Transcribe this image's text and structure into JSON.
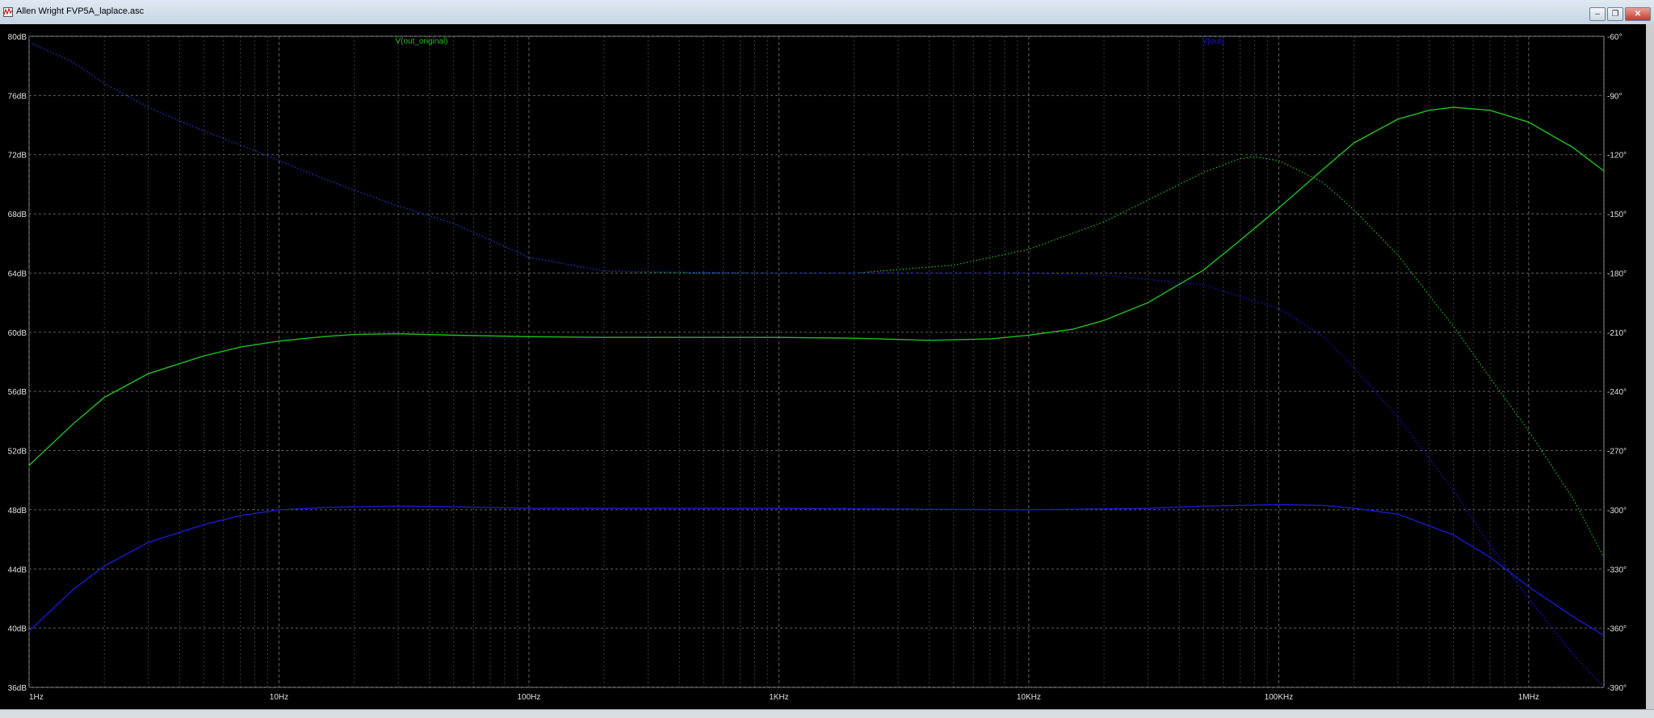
{
  "window": {
    "title": "Allen Wright FVP5A_laplace.asc"
  },
  "icons": {
    "app": "ltspice-waveform-icon",
    "minimize": "minimize-icon",
    "restore": "restore-icon",
    "close": "close-icon"
  },
  "colors": {
    "green": "#1fbf1f",
    "blue": "#1a1ad0",
    "grid": "#6a6a6a",
    "axis_text": "#e0e0e0",
    "background": "#000000"
  },
  "chart_data": {
    "type": "line",
    "title": "",
    "xscale": "log",
    "xlim": [
      1,
      2000000
    ],
    "ylim": [
      36,
      80
    ],
    "y2lim": [
      -390,
      -60
    ],
    "xticks": [
      {
        "value": 1,
        "label": "1Hz"
      },
      {
        "value": 10,
        "label": "10Hz"
      },
      {
        "value": 100,
        "label": "100Hz"
      },
      {
        "value": 1000,
        "label": "1KHz"
      },
      {
        "value": 10000,
        "label": "10KHz"
      },
      {
        "value": 100000,
        "label": "100KHz"
      },
      {
        "value": 1000000,
        "label": "1MHz"
      }
    ],
    "yticks": [
      {
        "value": 80,
        "label": "80dB"
      },
      {
        "value": 76,
        "label": "76dB"
      },
      {
        "value": 72,
        "label": "72dB"
      },
      {
        "value": 68,
        "label": "68dB"
      },
      {
        "value": 64,
        "label": "64dB"
      },
      {
        "value": 60,
        "label": "60dB"
      },
      {
        "value": 56,
        "label": "56dB"
      },
      {
        "value": 52,
        "label": "52dB"
      },
      {
        "value": 48,
        "label": "48dB"
      },
      {
        "value": 44,
        "label": "44dB"
      },
      {
        "value": 40,
        "label": "40dB"
      },
      {
        "value": 36,
        "label": "36dB"
      }
    ],
    "y2ticks": [
      {
        "value": -60,
        "label": "-60°"
      },
      {
        "value": -90,
        "label": "-90°"
      },
      {
        "value": -120,
        "label": "-120°"
      },
      {
        "value": -150,
        "label": "-150°"
      },
      {
        "value": -180,
        "label": "-180°"
      },
      {
        "value": -210,
        "label": "-210°"
      },
      {
        "value": -240,
        "label": "-240°"
      },
      {
        "value": -270,
        "label": "-270°"
      },
      {
        "value": -300,
        "label": "-300°"
      },
      {
        "value": -330,
        "label": "-330°"
      },
      {
        "value": -360,
        "label": "-360°"
      },
      {
        "value": -390,
        "label": "-390°"
      }
    ],
    "grid": true,
    "legend": [
      {
        "label": "V(out_original)",
        "color": "#1fbf1f",
        "position": "top-left"
      },
      {
        "label": "V(out)",
        "color": "#1a1ad0",
        "position": "top-right"
      }
    ],
    "series": [
      {
        "name": "V(out_original)",
        "quantity": "magnitude",
        "axis": "left",
        "style": "solid",
        "color": "#1fbf1f",
        "x": [
          1,
          1.5,
          2,
          3,
          5,
          7,
          10,
          15,
          20,
          30,
          50,
          100,
          200,
          500,
          1000,
          2000,
          4000,
          7000,
          10000,
          15000,
          20000,
          30000,
          50000,
          70000,
          100000,
          150000,
          200000,
          300000,
          400000,
          500000,
          700000,
          1000000,
          1500000,
          2000000
        ],
        "y": [
          51,
          53.8,
          55.6,
          57.2,
          58.4,
          59.0,
          59.4,
          59.7,
          59.85,
          59.9,
          59.8,
          59.7,
          59.65,
          59.65,
          59.65,
          59.6,
          59.45,
          59.55,
          59.8,
          60.2,
          60.8,
          62.0,
          64.2,
          66.2,
          68.4,
          71.0,
          72.8,
          74.4,
          75.0,
          75.2,
          75.0,
          74.2,
          72.5,
          70.9
        ]
      },
      {
        "name": "V(out_original)",
        "quantity": "phase",
        "axis": "right",
        "style": "dotted",
        "color": "#1fbf1f",
        "x": [
          1,
          1.5,
          2,
          3,
          5,
          7,
          10,
          15,
          20,
          30,
          50,
          100,
          200,
          500,
          1000,
          2000,
          5000,
          10000,
          20000,
          30000,
          50000,
          70000,
          80000,
          100000,
          150000,
          200000,
          300000,
          500000,
          700000,
          1000000,
          1500000,
          2000000
        ],
        "y": [
          -63,
          -73,
          -84,
          -96,
          -108,
          -115,
          -123,
          -132,
          -138,
          -146,
          -155,
          -172,
          -179,
          -180,
          -180,
          -180,
          -176,
          -168,
          -154,
          -143,
          -129,
          -122,
          -121,
          -123,
          -134,
          -148,
          -171,
          -207,
          -233,
          -260,
          -294,
          -324
        ]
      },
      {
        "name": "V(out)",
        "quantity": "magnitude",
        "axis": "left",
        "style": "solid",
        "color": "#1a1ad0",
        "x": [
          1,
          1.5,
          2,
          3,
          5,
          7,
          10,
          15,
          20,
          30,
          50,
          100,
          1000,
          10000,
          30000,
          50000,
          100000,
          150000,
          200000,
          300000,
          500000,
          700000,
          1000000,
          1500000,
          2000000
        ],
        "y": [
          39.8,
          42.6,
          44.2,
          45.8,
          47.0,
          47.6,
          48.0,
          48.15,
          48.2,
          48.25,
          48.2,
          48.1,
          48.1,
          48.0,
          48.1,
          48.25,
          48.35,
          48.3,
          48.1,
          47.7,
          46.3,
          44.8,
          42.8,
          40.8,
          39.5
        ]
      },
      {
        "name": "V(out)",
        "quantity": "phase",
        "axis": "right",
        "style": "dotted",
        "color": "#1a1ad0",
        "x": [
          1,
          1.5,
          2,
          3,
          5,
          7,
          10,
          15,
          20,
          30,
          50,
          100,
          200,
          1000,
          10000,
          20000,
          50000,
          100000,
          150000,
          200000,
          300000,
          500000,
          700000,
          1000000,
          1500000,
          2000000
        ],
        "y": [
          -63,
          -73,
          -84,
          -96,
          -108,
          -115,
          -123,
          -132,
          -138,
          -146,
          -155,
          -172,
          -179,
          -180,
          -180,
          -181,
          -186,
          -198,
          -212,
          -228,
          -253,
          -290,
          -318,
          -345,
          -373,
          -390
        ]
      }
    ]
  }
}
